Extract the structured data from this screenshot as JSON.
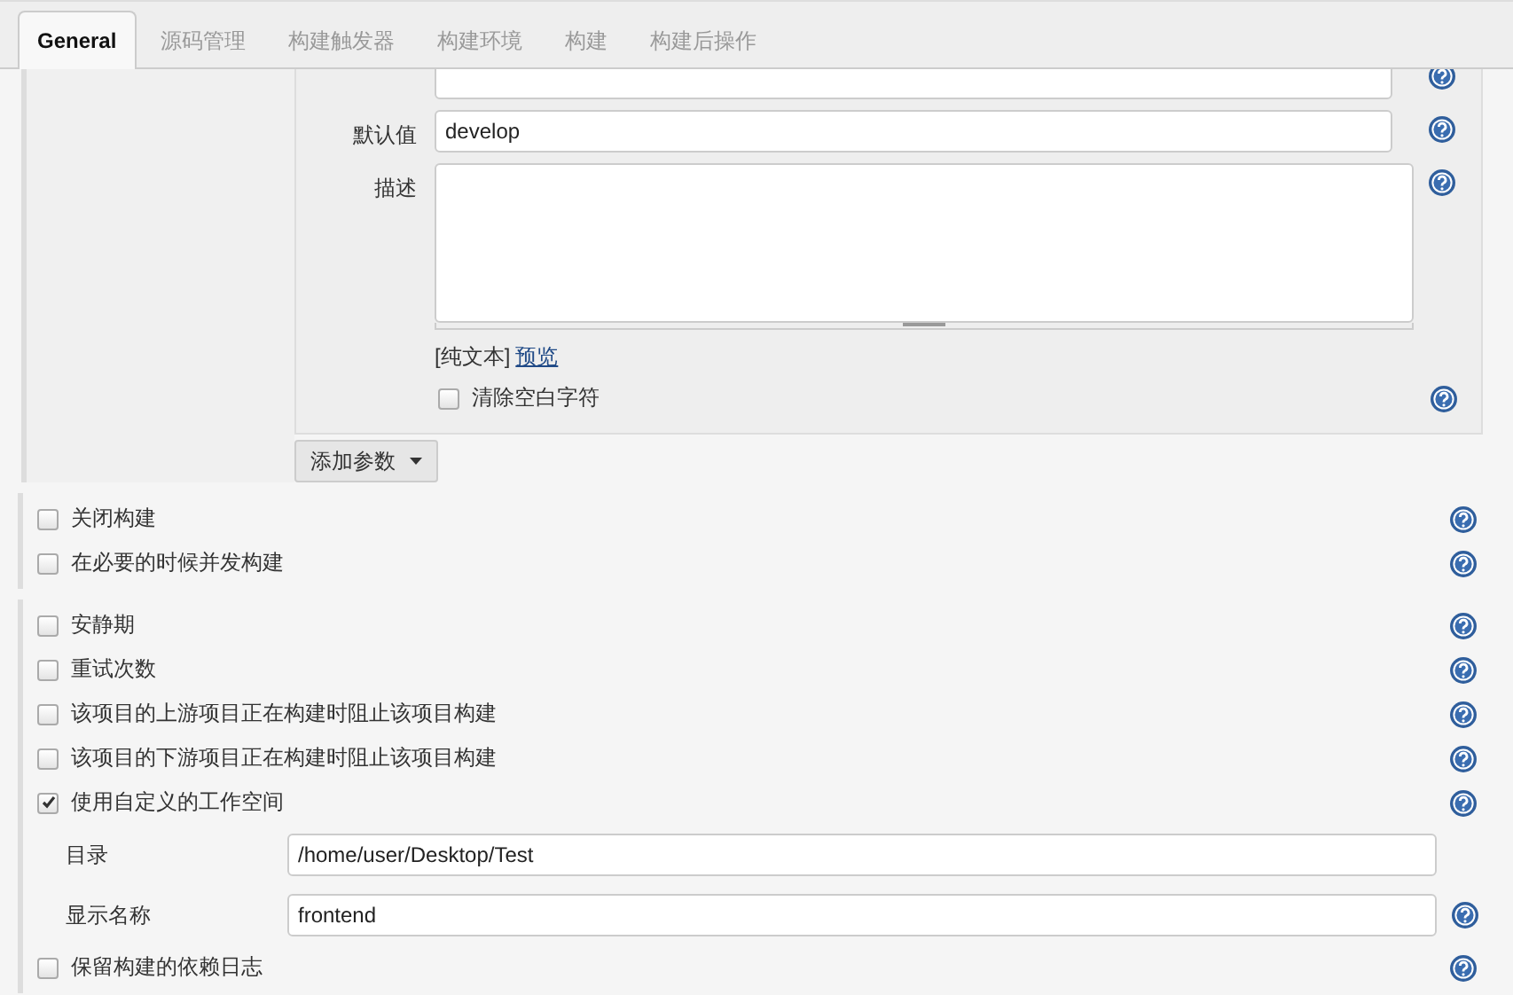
{
  "tabs": [
    {
      "label": "General",
      "selected": true
    },
    {
      "label": "源码管理",
      "selected": false
    },
    {
      "label": "构建触发器",
      "selected": false
    },
    {
      "label": "构建环境",
      "selected": false
    },
    {
      "label": "构建",
      "selected": false
    },
    {
      "label": "构建后操作",
      "selected": false
    }
  ],
  "parameter": {
    "fields": [
      {
        "label": "默认值",
        "value": "develop"
      }
    ],
    "description_label": "描述",
    "format_note": "[纯文本]",
    "preview_link": "预览",
    "trim": {
      "label": "清除空白字符",
      "checked": false
    }
  },
  "add_button": "添加参数",
  "option_groups": [
    {
      "items": [
        {
          "kind": "check",
          "label": "关闭构建",
          "checked": false
        },
        {
          "kind": "check",
          "label": "在必要的时候并发构建",
          "checked": false
        }
      ]
    },
    {
      "items": [
        {
          "kind": "check",
          "label": "安静期",
          "checked": false
        },
        {
          "kind": "check",
          "label": "重试次数",
          "checked": false
        },
        {
          "kind": "check",
          "label": "该项目的上游项目正在构建时阻止该项目构建",
          "checked": false
        },
        {
          "kind": "check",
          "label": "该项目的下游项目正在构建时阻止该项目构建",
          "checked": false
        },
        {
          "kind": "check",
          "label": "使用自定义的工作空间",
          "checked": true
        },
        {
          "kind": "field",
          "label": "目录",
          "value": "/home/user/Desktop/Test",
          "help": false
        },
        {
          "kind": "field",
          "label": "显示名称",
          "value": "frontend",
          "help": true
        },
        {
          "kind": "check",
          "label": "保留构建的依赖日志",
          "checked": false
        }
      ]
    }
  ]
}
